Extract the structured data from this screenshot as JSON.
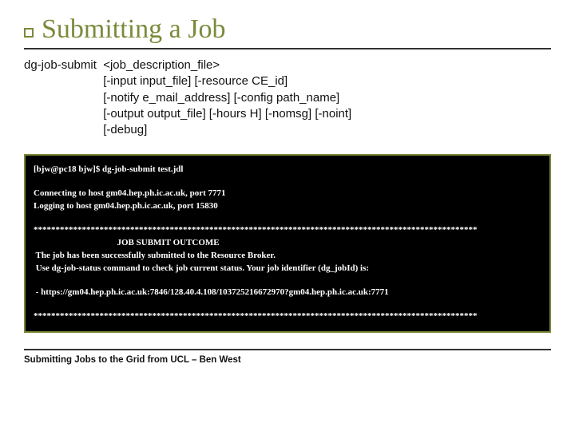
{
  "title": "Submitting a Job",
  "syntax": {
    "cmd": "dg-job-submit  ",
    "args": "<job_description_file>\n[-input input_file] [-resource CE_id]\n[-notify e_mail_address] [-config path_name]\n[-output output_file] [-hours H] [-nomsg] [-noint]\n[-debug]"
  },
  "terminal": [
    "[bjw@pc18 bjw]$ dg-job-submit test.jdl",
    "",
    "Connecting to host gm04.hep.ph.ic.ac.uk, port 7771",
    "Logging to host gm04.hep.ph.ic.ac.uk, port 15830",
    "",
    "*****************************************************************************************************",
    "                                      JOB SUBMIT OUTCOME",
    " The job has been successfully submitted to the Resource Broker.",
    " Use dg-job-status command to check job current status. Your job identifier (dg_jobId) is:",
    "",
    " - https://gm04.hep.ph.ic.ac.uk:7846/128.40.4.108/103725216672970?gm04.hep.ph.ic.ac.uk:7771",
    "",
    "*****************************************************************************************************"
  ],
  "footer": "Submitting Jobs to the Grid from UCL – Ben West"
}
